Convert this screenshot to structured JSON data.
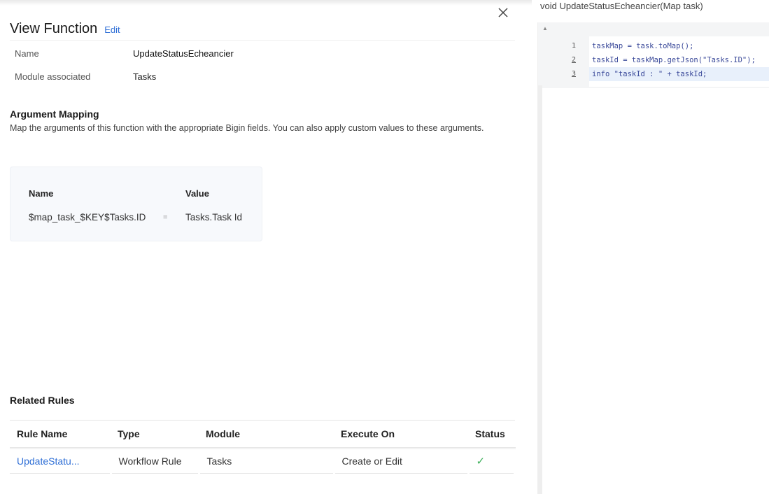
{
  "header": {
    "title": "View Function",
    "edit_label": "Edit"
  },
  "info": {
    "name_label": "Name",
    "name_value": "UpdateStatusEcheancier",
    "module_label": "Module associated",
    "module_value": "Tasks"
  },
  "argument_mapping": {
    "title": "Argument Mapping",
    "description": "Map the arguments of this function with the appropriate Bigin fields. You can also apply custom values to these arguments.",
    "col_name": "Name",
    "col_value": "Value",
    "rows": [
      {
        "name": "$map_task_$KEY$Tasks.ID",
        "operator": "=",
        "value": "Tasks.Task Id"
      }
    ]
  },
  "related_rules": {
    "title": "Related Rules",
    "columns": [
      "Rule Name",
      "Type",
      "Module",
      "Execute On",
      "Status"
    ],
    "rows": [
      {
        "rule_name": "UpdateStatu...",
        "type": "Workflow Rule",
        "module": "Tasks",
        "execute_on": "Create or Edit",
        "status": "✓"
      }
    ]
  },
  "code_panel": {
    "signature": "void UpdateStatusEcheancier(Map task)",
    "lines": [
      {
        "num": "1",
        "text": "taskMap = task.toMap();"
      },
      {
        "num": "2",
        "text": "taskId = taskMap.getJson(\"Tasks.ID\");"
      },
      {
        "num": "3",
        "text": "info \"taskId : \" + taskId;"
      }
    ]
  },
  "colors": {
    "link": "#2f6fd6",
    "status_ok": "#3eb05b",
    "active_line": "#e8f0fb"
  }
}
